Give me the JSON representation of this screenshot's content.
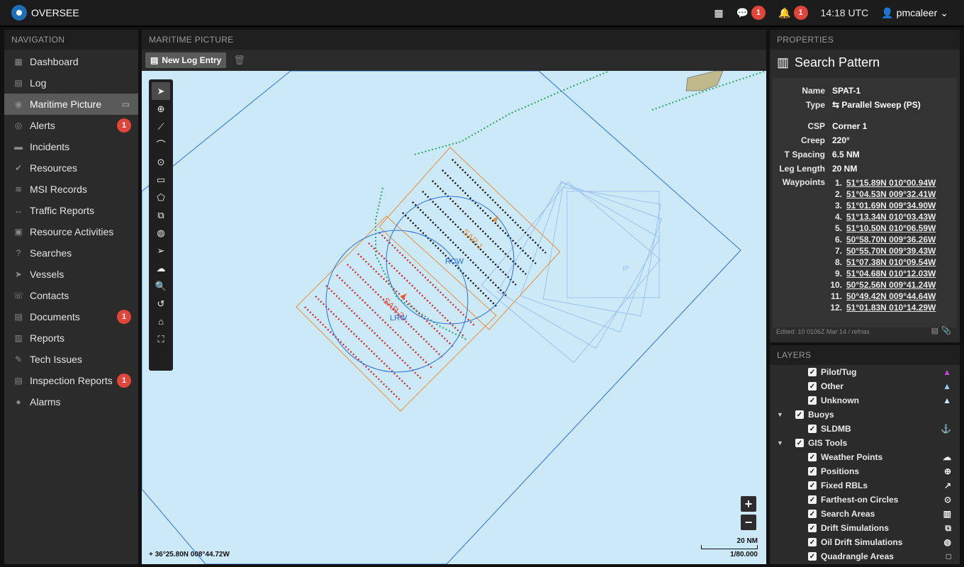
{
  "app": {
    "name": "OVERSEE"
  },
  "topbar": {
    "chat_count": "1",
    "alerts_count": "1",
    "time": "14:18 UTC",
    "user": "pmcaleer"
  },
  "nav": {
    "header": "NAVIGATION",
    "items": [
      {
        "label": "Dashboard"
      },
      {
        "label": "Log"
      },
      {
        "label": "Maritime Picture"
      },
      {
        "label": "Alerts",
        "badge": "1"
      },
      {
        "label": "Incidents"
      },
      {
        "label": "Resources"
      },
      {
        "label": "MSI Records"
      },
      {
        "label": "Traffic Reports"
      },
      {
        "label": "Resource Activities"
      },
      {
        "label": "Searches"
      },
      {
        "label": "Vessels"
      },
      {
        "label": "Contacts"
      },
      {
        "label": "Documents",
        "badge": "1"
      },
      {
        "label": "Reports"
      },
      {
        "label": "Tech Issues"
      },
      {
        "label": "Inspection Reports",
        "badge": "1"
      },
      {
        "label": "Alarms"
      }
    ]
  },
  "main": {
    "header": "MARITIME PICTURE",
    "new_log_label": "New Log Entry",
    "map": {
      "coords": "36°25.80N 008°44.72W",
      "scale_label": "20 NM",
      "scale_ratio": "1/80.000",
      "labels": {
        "sar1": "SAR-1",
        "sar2": "SAR-2",
        "lrw": "LRW",
        "rcw": "RCW",
        "ip": "IP"
      }
    }
  },
  "properties": {
    "header": "PROPERTIES",
    "title": "Search Pattern",
    "fields": {
      "name_k": "Name",
      "name_v": "SPAT-1",
      "type_k": "Type",
      "type_v": "Parallel Sweep (PS)",
      "csp_k": "CSP",
      "csp_v": "Corner 1",
      "creep_k": "Creep",
      "creep_v": "220°",
      "tsp_k": "T Spacing",
      "tsp_v": "6.5 NM",
      "leg_k": "Leg Length",
      "leg_v": "20 NM",
      "wp_k": "Waypoints"
    },
    "waypoints": [
      {
        "n": "1.",
        "v": "51°15.89N 010°00.94W"
      },
      {
        "n": "2.",
        "v": "51°04.53N 009°32.41W"
      },
      {
        "n": "3.",
        "v": "51°01.69N 009°34.90W"
      },
      {
        "n": "4.",
        "v": "51°13.34N 010°03.43W"
      },
      {
        "n": "5.",
        "v": "51°10.50N 010°06.59W"
      },
      {
        "n": "6.",
        "v": "50°58.70N 009°36.26W"
      },
      {
        "n": "7.",
        "v": "50°55.70N 009°39.43W"
      },
      {
        "n": "8.",
        "v": "51°07.38N 010°09.54W"
      },
      {
        "n": "9.",
        "v": "51°04.68N 010°12.03W"
      },
      {
        "n": "10.",
        "v": "50°52.56N 009°41.24W"
      },
      {
        "n": "11.",
        "v": "50°49.42N 009°44.64W"
      },
      {
        "n": "12.",
        "v": "51°01.83N 010°14.29W"
      }
    ],
    "edited": "Edited: 10 0106Z Mar 14 / refrias"
  },
  "layers": {
    "header": "LAYERS",
    "rows": [
      {
        "label": "Pilot/Tug",
        "indent": 2,
        "icon": "▲",
        "color": "#c545d8"
      },
      {
        "label": "Other",
        "indent": 2,
        "icon": "▲",
        "color": "#9ad0f5"
      },
      {
        "label": "Unknown",
        "indent": 2,
        "icon": "▲",
        "color": "#cfe8fa"
      },
      {
        "label": "Buoys",
        "indent": 1,
        "group": true
      },
      {
        "label": "SLDMB",
        "indent": 2,
        "icon": "⚓",
        "color": "#d9c92a"
      },
      {
        "label": "GIS Tools",
        "indent": 1,
        "group": true
      },
      {
        "label": "Weather Points",
        "indent": 2,
        "icon": "☁",
        "color": "#eee"
      },
      {
        "label": "Positions",
        "indent": 2,
        "icon": "⊕",
        "color": "#eee"
      },
      {
        "label": "Fixed RBLs",
        "indent": 2,
        "icon": "↗",
        "color": "#eee"
      },
      {
        "label": "Farthest-on Circles",
        "indent": 2,
        "icon": "⊙",
        "color": "#eee"
      },
      {
        "label": "Search Areas",
        "indent": 2,
        "icon": "▥",
        "color": "#eee"
      },
      {
        "label": "Drift Simulations",
        "indent": 2,
        "icon": "⧉",
        "color": "#eee"
      },
      {
        "label": "Oil Drift Simulations",
        "indent": 2,
        "icon": "◍",
        "color": "#eee"
      },
      {
        "label": "Quadrangle Areas",
        "indent": 2,
        "icon": "□",
        "color": "#eee"
      }
    ]
  }
}
